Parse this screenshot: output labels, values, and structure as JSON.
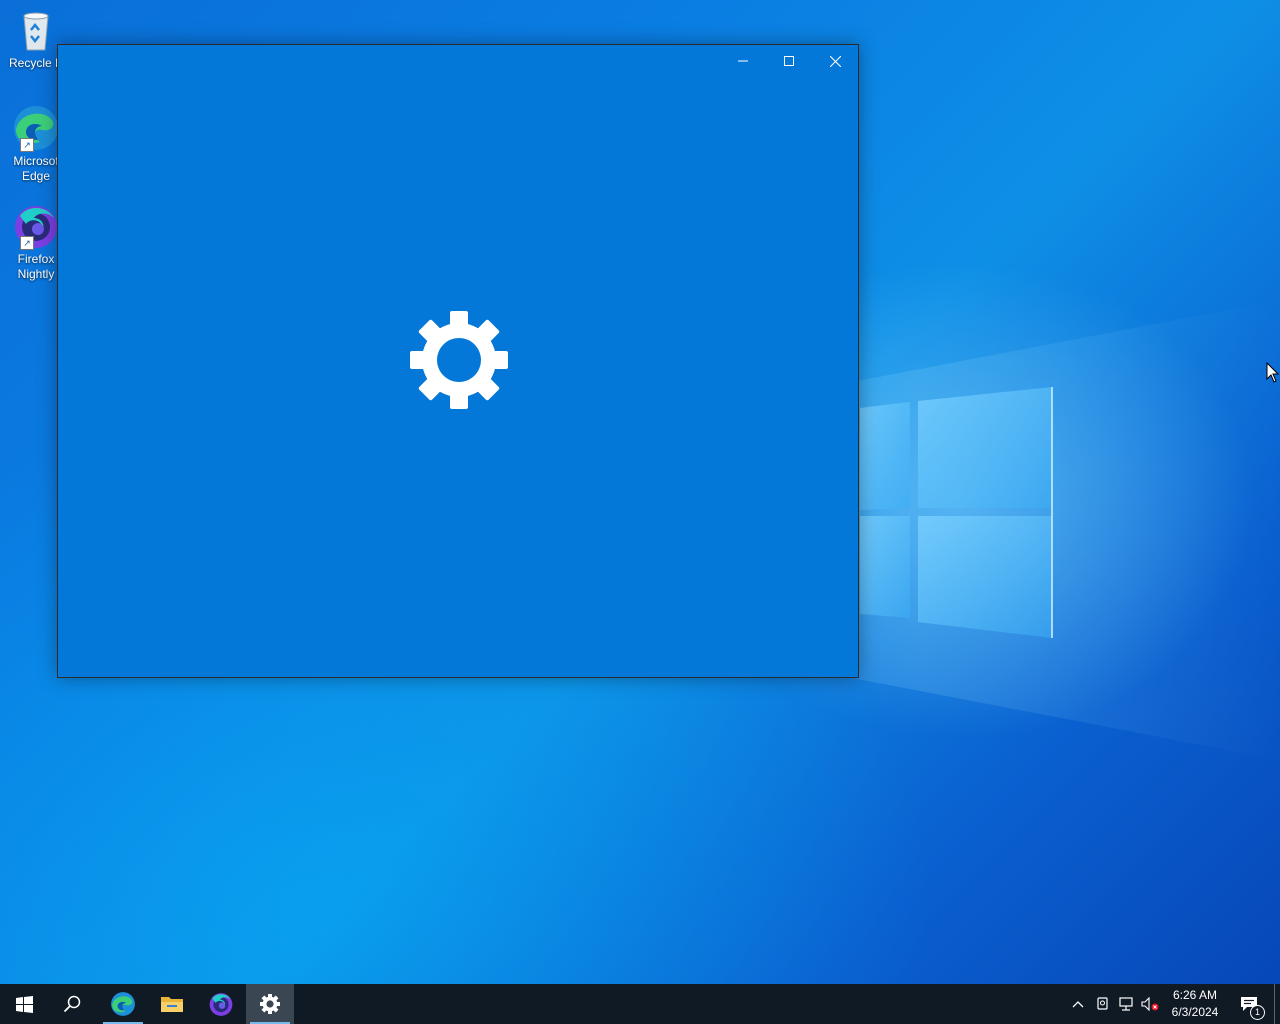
{
  "desktop": {
    "icons": [
      {
        "label": "Recycle B",
        "icon": "recycle-bin-icon"
      },
      {
        "label": "Microsof\nEdge",
        "icon": "edge-icon"
      },
      {
        "label": "Firefox\nNightly",
        "icon": "firefox-nightly-icon"
      }
    ]
  },
  "window": {
    "title": "",
    "splash_icon": "gear-icon",
    "background_color": "#0478d8",
    "controls": [
      "minimize",
      "maximize",
      "close"
    ]
  },
  "taskbar": {
    "apps": [
      {
        "name": "start",
        "icon": "windows-start-icon"
      },
      {
        "name": "search",
        "icon": "search-icon"
      },
      {
        "name": "edge",
        "icon": "edge-icon",
        "running": true
      },
      {
        "name": "file-explorer",
        "icon": "folder-icon"
      },
      {
        "name": "firefox-nightly",
        "icon": "firefox-nightly-icon"
      },
      {
        "name": "settings",
        "icon": "gear-icon",
        "running": true,
        "active": true
      }
    ],
    "tray": {
      "icons": [
        "chevron-up-icon",
        "meet-now-icon",
        "network-icon",
        "volume-muted-icon"
      ],
      "time": "6:26 AM",
      "date": "6/3/2024",
      "notification_count": "1"
    }
  },
  "colors": {
    "accent": "#0478d8",
    "taskbar": "#101a24",
    "running_indicator": "#76b9ed"
  }
}
